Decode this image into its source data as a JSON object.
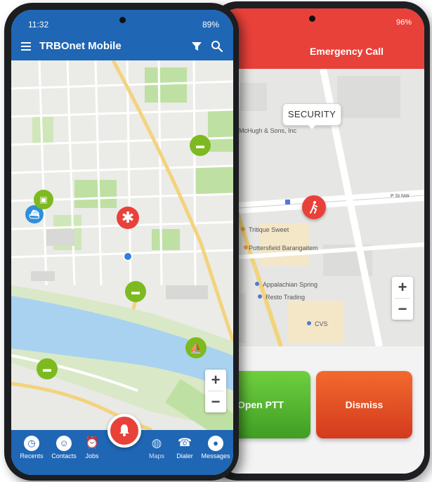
{
  "back_phone": {
    "battery": "96%",
    "header_title": "Emergency Call",
    "callout_label": "SECURITY",
    "open_ptt_label": "Open PTT",
    "dismiss_label": "Dismiss",
    "map_labels": [
      "McHugh & Sons, Inc",
      "Tritique Sweet",
      "Pottersfield Barangaitem",
      "Appalachian Spring",
      "Resto Trading",
      "CVS",
      "P St NW"
    ],
    "zoom_in": "+",
    "zoom_out": "−"
  },
  "front_phone": {
    "time": "11:32",
    "battery": "89%",
    "app_title": "TRBOnet Mobile",
    "zoom_in": "+",
    "zoom_out": "−",
    "nav": [
      {
        "label": "Recents",
        "icon": "clock-icon"
      },
      {
        "label": "Contacts",
        "icon": "contacts-icon"
      },
      {
        "label": "Jobs",
        "icon": "alarm-clock-icon"
      },
      {
        "label": "Maps",
        "icon": "globe-icon"
      },
      {
        "label": "Dialer",
        "icon": "dialer-icon"
      },
      {
        "label": "Messages",
        "icon": "chat-bubble-icon"
      }
    ]
  },
  "colors": {
    "brand_blue": "#1f66b4",
    "emergency_red": "#e8413a",
    "ptt_green": "#4caf2a",
    "dismiss_orange": "#e4512a",
    "vehicle_green": "#7dba1f"
  }
}
